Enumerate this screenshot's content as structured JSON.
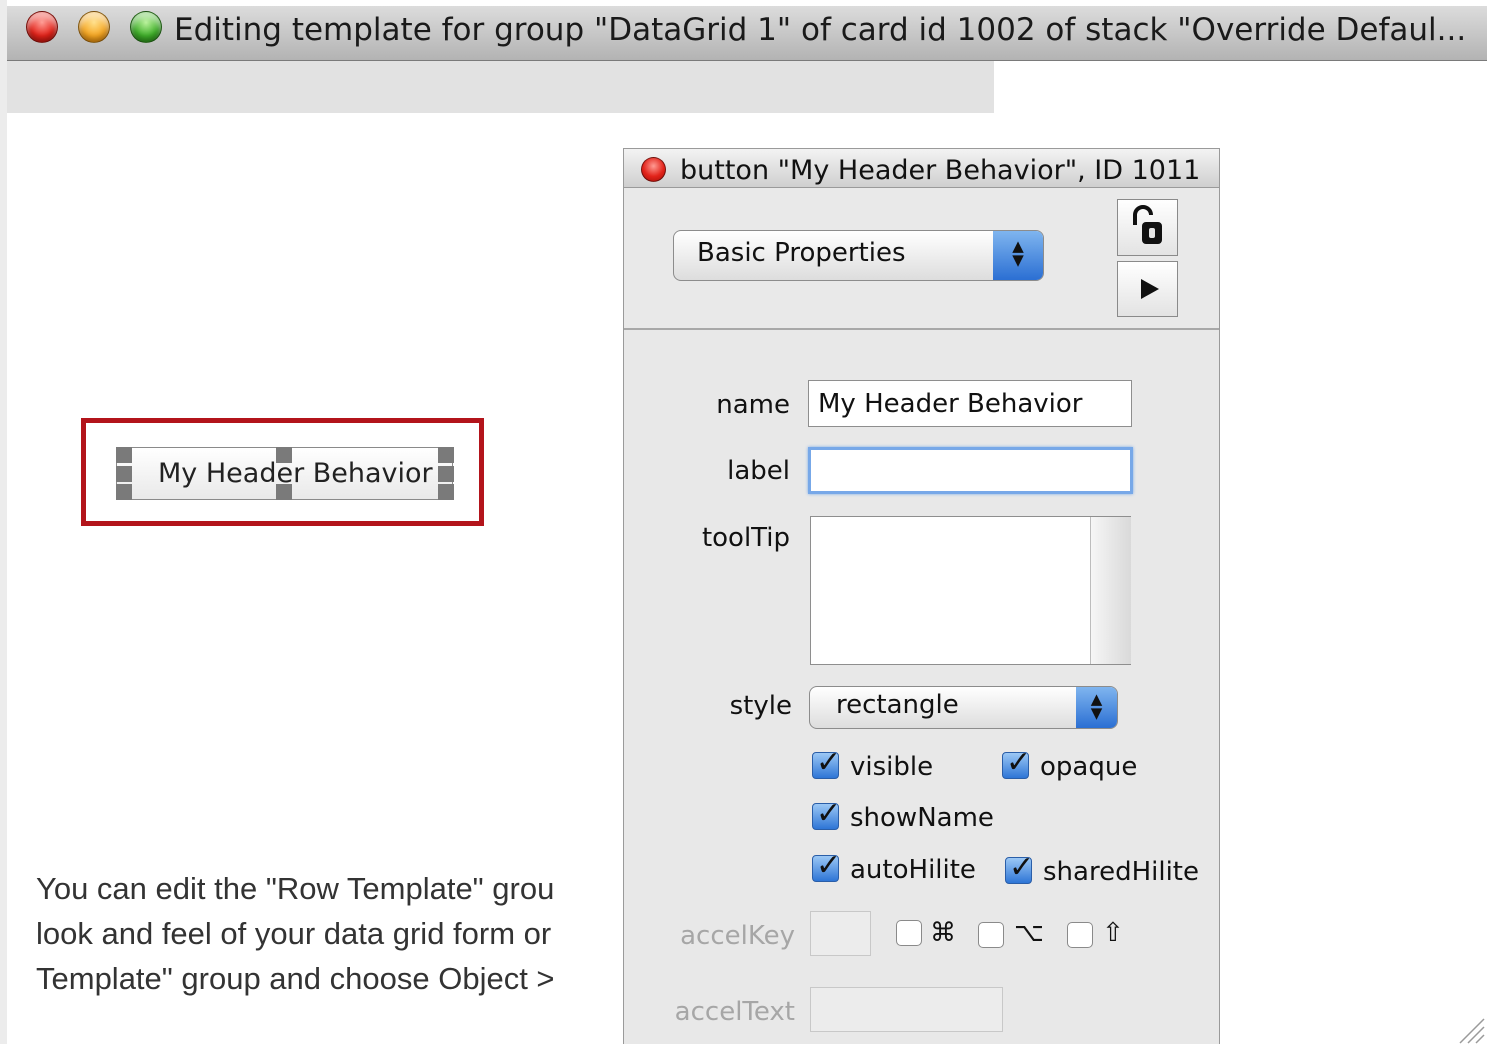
{
  "window": {
    "title": "Editing template for group \"DataGrid 1\" of card id 1002 of stack \"Override Defaul..."
  },
  "canvas": {
    "selected_button_label": "My Header Behavior",
    "help_lines": [
      "You can edit the \"Row Template\" grou",
      "look and feel of your data grid form or",
      "Template\" group and choose Object >"
    ]
  },
  "inspector": {
    "title": "button \"My Header Behavior\", ID 1011",
    "pane_selector": "Basic Properties",
    "fields": {
      "name_label": "name",
      "name_value": "My Header Behavior",
      "label_label": "label",
      "label_value": "",
      "tooltip_label": "toolTip",
      "tooltip_value": "",
      "style_label": "style",
      "style_value": "rectangle"
    },
    "checkboxes": [
      {
        "label": "visible",
        "checked": true
      },
      {
        "label": "opaque",
        "checked": true
      },
      {
        "label": "showName",
        "checked": true
      },
      {
        "label": "autoHilite",
        "checked": true
      },
      {
        "label": "sharedHilite",
        "checked": true
      }
    ],
    "accel": {
      "accelkey_label": "accelKey",
      "acceltext_label": "accelText",
      "modifiers": [
        {
          "symbol": "⌘",
          "checked": false
        },
        {
          "symbol": "⌥",
          "checked": false
        },
        {
          "symbol": "⇧",
          "checked": false
        }
      ]
    },
    "icons": {
      "lock": "unlocked-padlock-icon",
      "play": "play-icon"
    }
  },
  "colors": {
    "selection_frame": "#b3141b",
    "focus_ring": "#77a8e8",
    "checkbox_blue": "#2e75d6"
  }
}
